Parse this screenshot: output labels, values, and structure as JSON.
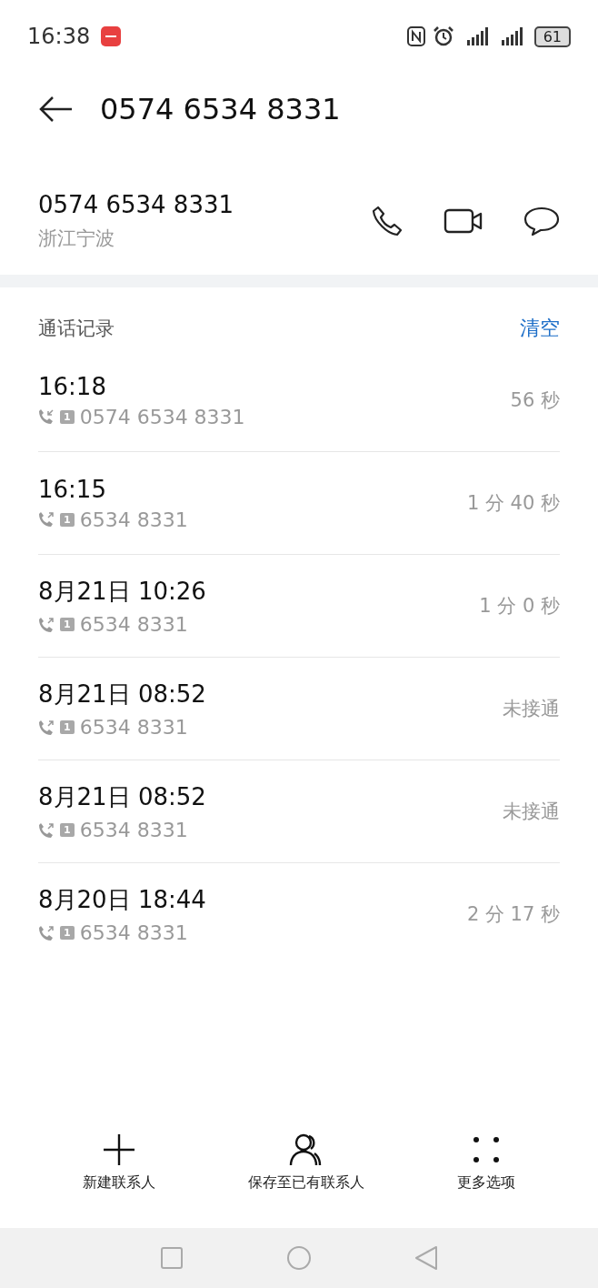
{
  "status_bar": {
    "time": "16:38",
    "battery": "61"
  },
  "header": {
    "title": "0574 6534 8331"
  },
  "contact": {
    "number": "0574 6534 8331",
    "location": "浙江宁波"
  },
  "call_log": {
    "title": "通话记录",
    "clear": "清空",
    "rows": [
      {
        "time": "16:18",
        "kind": "incoming",
        "sim": "1",
        "number": "0574 6534 8331",
        "duration": "56 秒"
      },
      {
        "time": "16:15",
        "kind": "outgoing",
        "sim": "1",
        "number": "6534 8331",
        "duration": "1 分 40 秒"
      },
      {
        "time": "8月21日 10:26",
        "kind": "outgoing",
        "sim": "1",
        "number": "6534 8331",
        "duration": "1 分 0 秒"
      },
      {
        "time": "8月21日 08:52",
        "kind": "outgoing",
        "sim": "1",
        "number": "6534 8331",
        "duration": "未接通"
      },
      {
        "time": "8月21日 08:52",
        "kind": "outgoing",
        "sim": "1",
        "number": "6534 8331",
        "duration": "未接通"
      },
      {
        "time": "8月20日 18:44",
        "kind": "outgoing",
        "sim": "1",
        "number": "6534 8331",
        "duration": "2 分 17 秒"
      }
    ]
  },
  "actions": [
    {
      "kind": "add",
      "label": "新建联系人"
    },
    {
      "kind": "person",
      "label": "保存至已有联系人"
    },
    {
      "kind": "more",
      "label": "更多选项"
    }
  ]
}
